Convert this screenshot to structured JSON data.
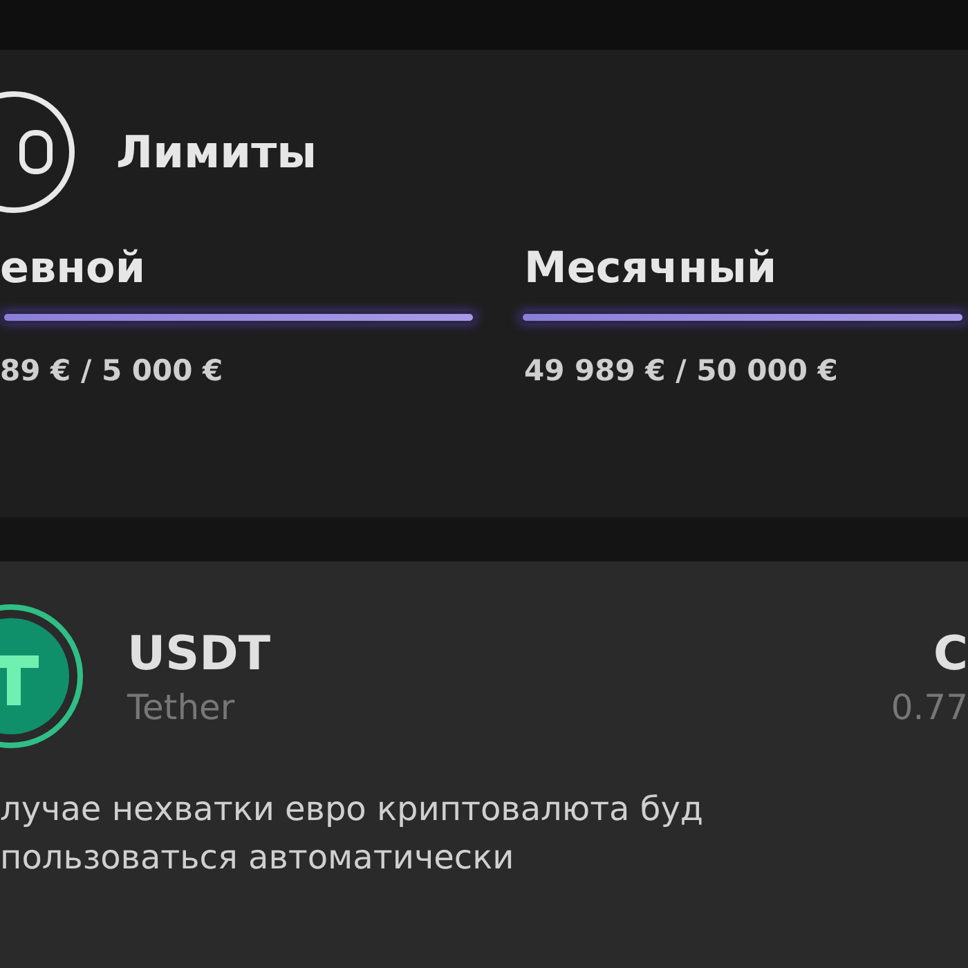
{
  "limits": {
    "title": "Лимиты",
    "items": [
      {
        "name": "евной",
        "level": 1.0,
        "reading": "89 € / 5 000 €"
      },
      {
        "name": "Месячный",
        "level": 0.998,
        "reading": "49 989 € / 50 000 €"
      }
    ]
  },
  "asset": {
    "symbol": "USDT",
    "name": "Tether",
    "column_3": "C",
    "column_4": "0.77",
    "note": "лучае нехватки евро криптовалюта буд\nпользоваться автоматически"
  }
}
